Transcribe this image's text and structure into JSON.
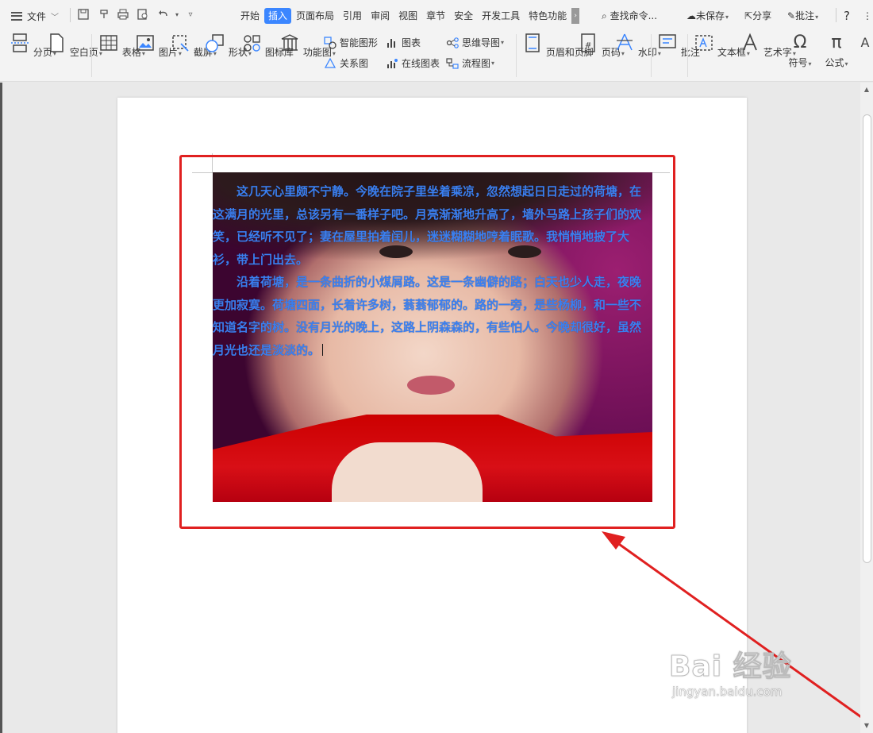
{
  "topbar": {
    "file_label": "文件",
    "tabs": [
      "开始",
      "插入",
      "页面布局",
      "引用",
      "审阅",
      "视图",
      "章节",
      "安全",
      "开发工具",
      "特色功能"
    ],
    "active_tab": "插入",
    "search_cmd": "查找命令...",
    "unsaved": "未保存",
    "share": "分享",
    "comment": "批注",
    "help": "?"
  },
  "ribbon": {
    "page_break": "分页",
    "blank_page": "空白页",
    "table": "表格",
    "picture": "图片",
    "screenshot": "截屏",
    "shape": "形状",
    "icon_lib": "图标库",
    "func_chart": "功能图",
    "smart_shape": "智能图形",
    "chart": "图表",
    "mind_map": "思维导图",
    "relation_chart": "关系图",
    "online_chart": "在线图表",
    "flowchart": "流程图",
    "header_footer": "页眉和页脚",
    "page_number": "页码",
    "watermark": "水印",
    "comment": "批注",
    "textbox": "文本框",
    "wordart": "艺术字",
    "symbol": "符号",
    "formula": "公式"
  },
  "document": {
    "paragraph1": "这几天心里颇不宁静。今晚在院子里坐着乘凉，忽然想起日日走过的荷塘，在这满月的光里，总该另有一番样子吧。月亮渐渐地升高了，墙外马路上孩子们的欢笑，已经听不见了；妻在屋里拍着闰儿，迷迷糊糊地哼着眠歌。我悄悄地披了大衫，带上门出去。",
    "paragraph2": "沿着荷塘，是一条曲折的小煤屑路。这是一条幽僻的路；白天也少人走，夜晚更加寂寞。荷塘四面，长着许多树，蓊蓊郁郁的。路的一旁，是些杨柳，和一些不知道名字的树。没有月光的晚上，这路上阴森森的，有些怕人。今晚却很好，虽然月光也还是淡淡的。"
  },
  "watermark": {
    "main": "Bai 经验",
    "sub": "jingyan.baidu.com"
  },
  "colors": {
    "text_overlay": "#3a7ff0",
    "annotation": "#e02020",
    "active_tab": "#3b86ff"
  }
}
